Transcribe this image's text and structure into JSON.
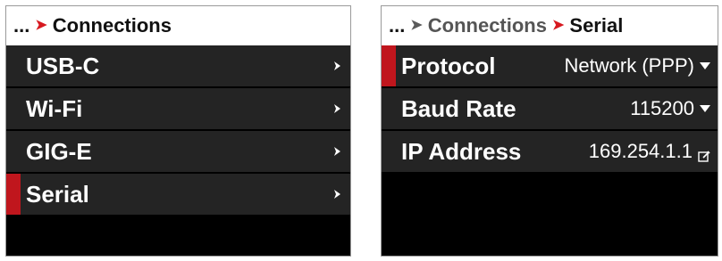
{
  "left_panel": {
    "breadcrumb": {
      "ellipsis": "...",
      "current": "Connections"
    },
    "items": [
      {
        "label": "USB-C",
        "icon": "chevron-right-icon"
      },
      {
        "label": "Wi-Fi",
        "icon": "chevron-right-icon"
      },
      {
        "label": "GIG-E",
        "icon": "chevron-right-icon"
      },
      {
        "label": "Serial",
        "icon": "chevron-right-icon",
        "selected": true
      }
    ]
  },
  "right_panel": {
    "breadcrumb": {
      "ellipsis": "...",
      "parent": "Connections",
      "current": "Serial"
    },
    "settings": [
      {
        "label": "Protocol",
        "value": "Network (PPP)",
        "control": "dropdown",
        "selected": true
      },
      {
        "label": "Baud Rate",
        "value": "115200",
        "control": "dropdown"
      },
      {
        "label": "IP Address",
        "value": "169.254.1.1",
        "control": "edit"
      }
    ]
  },
  "colors": {
    "accent_red": "#c0161d",
    "row_bg": "#242424",
    "panel_bg": "#000000",
    "header_bg": "#ffffff"
  }
}
